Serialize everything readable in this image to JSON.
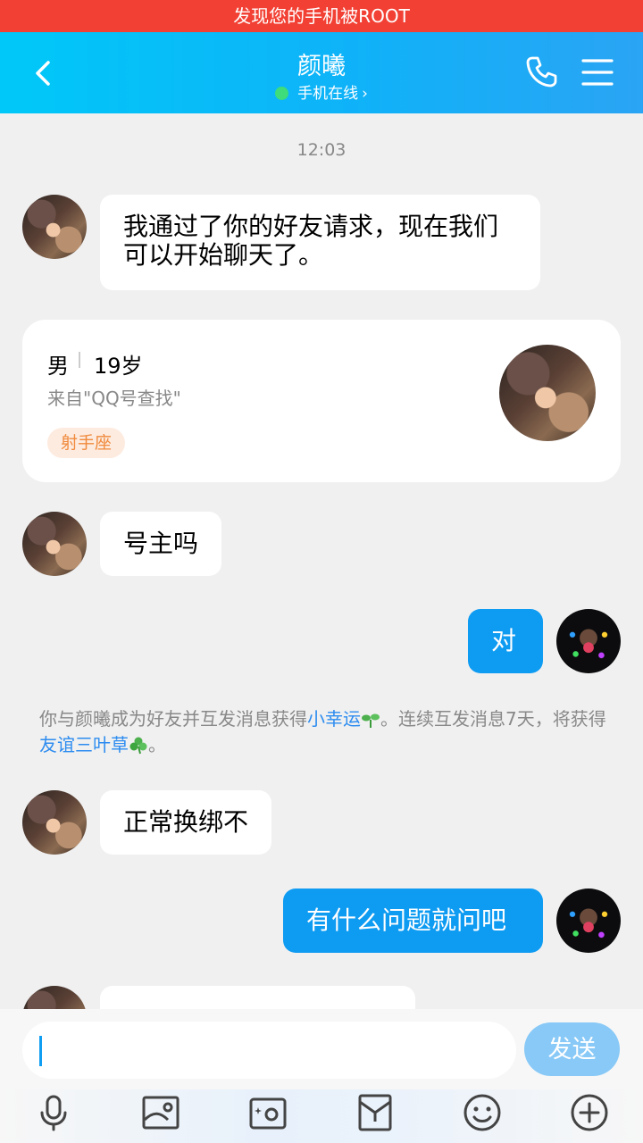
{
  "warning": {
    "text": "发现您的手机被ROOT",
    "color": "#f24134"
  },
  "header": {
    "contact_name": "颜曦",
    "status": "手机在线",
    "status_chevron": "›",
    "icons": [
      "back-icon",
      "phone-icon",
      "menu-icon"
    ]
  },
  "chat": {
    "timestamp": "12:03",
    "messages": [
      {
        "from": "contact",
        "text": "我通过了你的好友请求，现在我们可以开始聊天了。"
      },
      {
        "from": "contact",
        "text": "号主吗"
      },
      {
        "from": "me",
        "text": "对"
      },
      {
        "from": "contact",
        "text": "正常换绑不"
      },
      {
        "from": "me",
        "text": "有什么问题就问吧"
      }
    ],
    "profile_card": {
      "gender": "男",
      "age": "19岁",
      "source": "来自\"QQ号查找\"",
      "zodiac": "射手座"
    },
    "system_notice": {
      "part1": "你与颜曦成为好友并互发消息获得",
      "link1": "小幸运",
      "part2": "。连续互发消息7天，将获得",
      "link2": "友谊三叶草",
      "part3": "。"
    }
  },
  "composer": {
    "input_value": "",
    "send_label": "发送",
    "tools": [
      "microphone-icon",
      "image-icon",
      "camera-icon",
      "red-packet-icon",
      "emoji-icon",
      "plus-icon"
    ]
  },
  "colors": {
    "accent": "#0e9bf2",
    "header_gradient_start": "#00c8f8",
    "send_disabled": "#88c9f7"
  }
}
